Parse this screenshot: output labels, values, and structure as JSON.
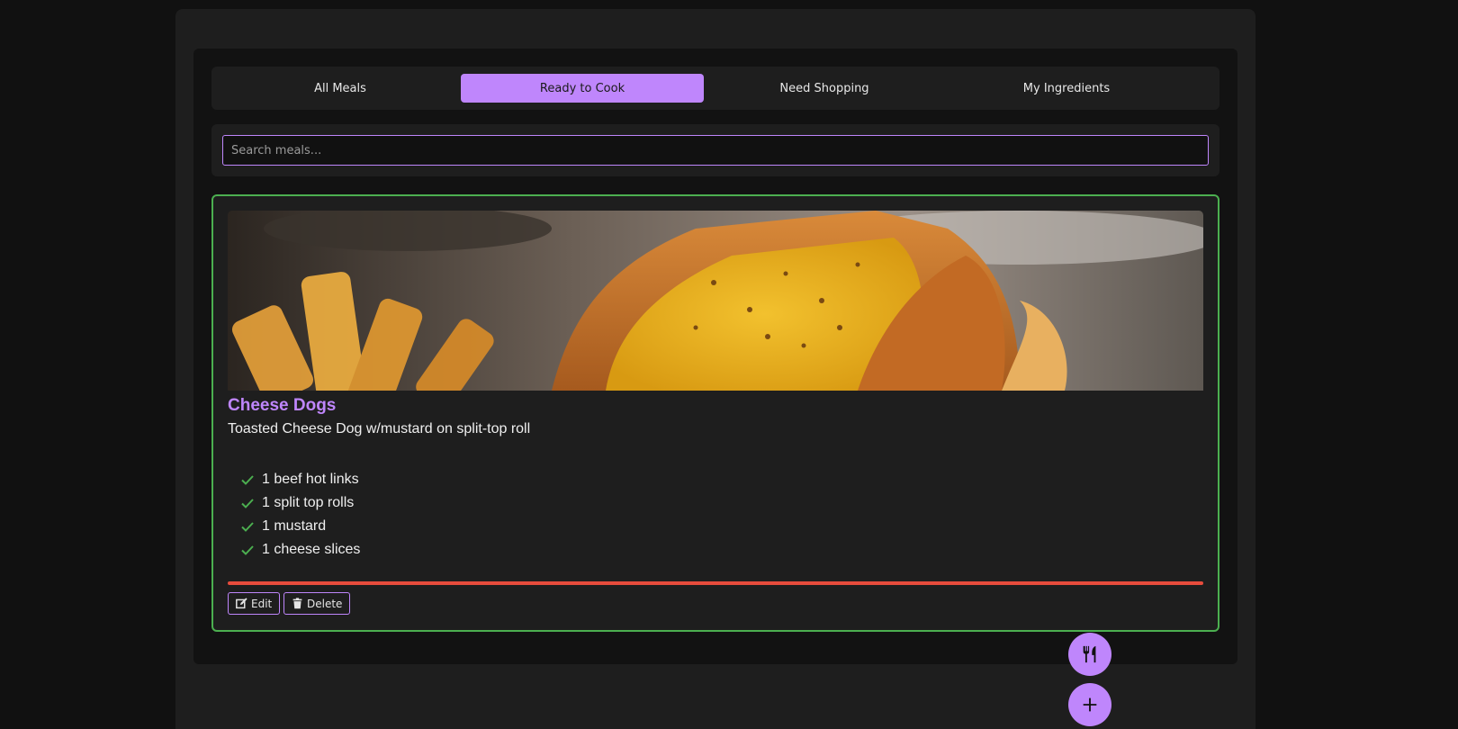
{
  "tabs": [
    {
      "label": "All Meals",
      "active": false
    },
    {
      "label": "Ready to Cook",
      "active": true
    },
    {
      "label": "Need Shopping",
      "active": false
    },
    {
      "label": "My Ingredients",
      "active": false
    }
  ],
  "search": {
    "placeholder": "Search meals...",
    "value": ""
  },
  "meal": {
    "title": "Cheese Dogs",
    "description": "Toasted Cheese Dog w/mustard on split-top roll",
    "image_icon": "cheese-dog-photo",
    "ingredients": [
      {
        "text": "1 beef hot links",
        "have": true
      },
      {
        "text": "1 split top rolls",
        "have": true
      },
      {
        "text": "1 mustard",
        "have": true
      },
      {
        "text": "1 cheese slices",
        "have": true
      }
    ],
    "progress_fraction": 1.0,
    "edit_label": "Edit",
    "delete_label": "Delete"
  },
  "fabs": {
    "meals_icon": "utensils-icon",
    "add_icon": "plus-icon"
  },
  "colors": {
    "accent": "#bf86fc",
    "ready_border": "#4caf50",
    "progress_bar": "#e74c3c",
    "check": "#4caf50",
    "background": "#111111",
    "panel": "#1e1e1e"
  }
}
